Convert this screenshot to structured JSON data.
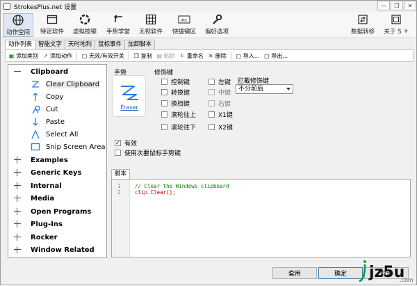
{
  "window": {
    "title": "StrokesPlus.net 设置"
  },
  "ribbon": {
    "items": [
      {
        "label": "动作空间",
        "icon": "globe-icon"
      },
      {
        "label": "特定软件",
        "icon": "app-window-icon"
      },
      {
        "label": "虚拟按键",
        "icon": "ring-icon"
      },
      {
        "label": "手势学堂",
        "icon": "gesture-arrow-icon"
      },
      {
        "label": "无视软件",
        "icon": "grid-icon"
      },
      {
        "label": "快捷键区",
        "icon": "keyboard-icon"
      },
      {
        "label": "偏好选项",
        "icon": "wrench-icon"
      },
      {
        "label": "数据转移",
        "icon": "transfer-icon"
      },
      {
        "label": "关于 S",
        "icon": "info-icon"
      }
    ]
  },
  "tabs": [
    "动作列表",
    "智能文字",
    "天时地利",
    "鼠标事件",
    "加卸脚本"
  ],
  "toolbar": {
    "add_category": "添加类别",
    "add_action": "添加动作",
    "toggle": "无效/有效开关",
    "copy": "复制",
    "paste": "粘贴",
    "rename": "重命名",
    "delete": "删除",
    "import": "导入...",
    "export": "导出..."
  },
  "tree": {
    "clipboard": "Clipboard",
    "clipboard_items": [
      "Clear Clipboard",
      "Copy",
      "Cut",
      "Paste",
      "Select All",
      "Snip Screen Area"
    ],
    "groups": [
      "Examples",
      "Generic Keys",
      "Internal",
      "Media",
      "Open Programs",
      "Plug-Ins",
      "Rocker",
      "Window Related"
    ]
  },
  "gesture": {
    "label": "手势",
    "name": "Eraser"
  },
  "modifiers": {
    "label": "修饰键",
    "col1": [
      "控制键",
      "转换键",
      "换档键",
      "滚轮往上",
      "滚轮往下"
    ],
    "col2": [
      "左键",
      "中键",
      "右键",
      "X1键",
      "X2键"
    ]
  },
  "intercept": {
    "label": "拦截修饰键",
    "value": "不分前后"
  },
  "options": {
    "enabled": "有效",
    "secondary": "使用次要鼠标手势键"
  },
  "script": {
    "tab": "脚本",
    "lines": [
      "// Clear the Windows clipboard",
      "clip.Clear();"
    ],
    "line_numbers": [
      "1",
      "2"
    ]
  },
  "buttons": {
    "apply": "套用",
    "ok": "确定",
    "cancel": "取消"
  },
  "watermark": {
    "text": "jz5u",
    "sub": ".com"
  }
}
